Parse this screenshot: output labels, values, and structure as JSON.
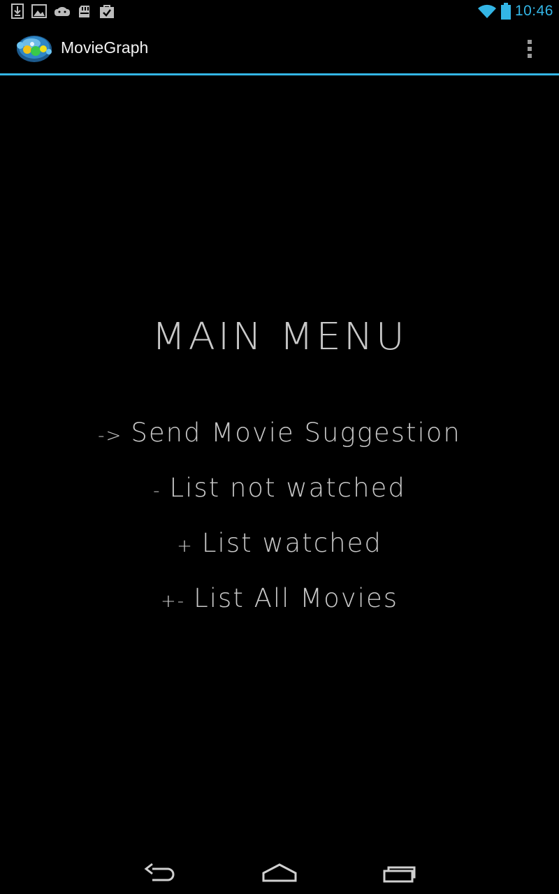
{
  "status_bar": {
    "time": "10:46",
    "left_icons": [
      "download-icon",
      "image-icon",
      "android-icon",
      "sd-card-icon",
      "shopping-bag-check-icon"
    ],
    "right_icons": [
      "wifi-icon",
      "battery-icon"
    ],
    "accent_color": "#33b5e5"
  },
  "action_bar": {
    "title": "MovieGraph",
    "logo_icon": "app-logo-icon",
    "overflow_icon": "overflow-menu-icon"
  },
  "main": {
    "title": "MAIN MENU",
    "items": [
      {
        "prefix": "->",
        "label": "Send Movie Suggestion"
      },
      {
        "prefix": "-",
        "label": "List not watched"
      },
      {
        "prefix": "+",
        "label": "List watched"
      },
      {
        "prefix": "+-",
        "label": "List All Movies"
      }
    ]
  },
  "nav_bar": {
    "buttons": [
      "back-icon",
      "home-icon",
      "recent-apps-icon"
    ]
  }
}
